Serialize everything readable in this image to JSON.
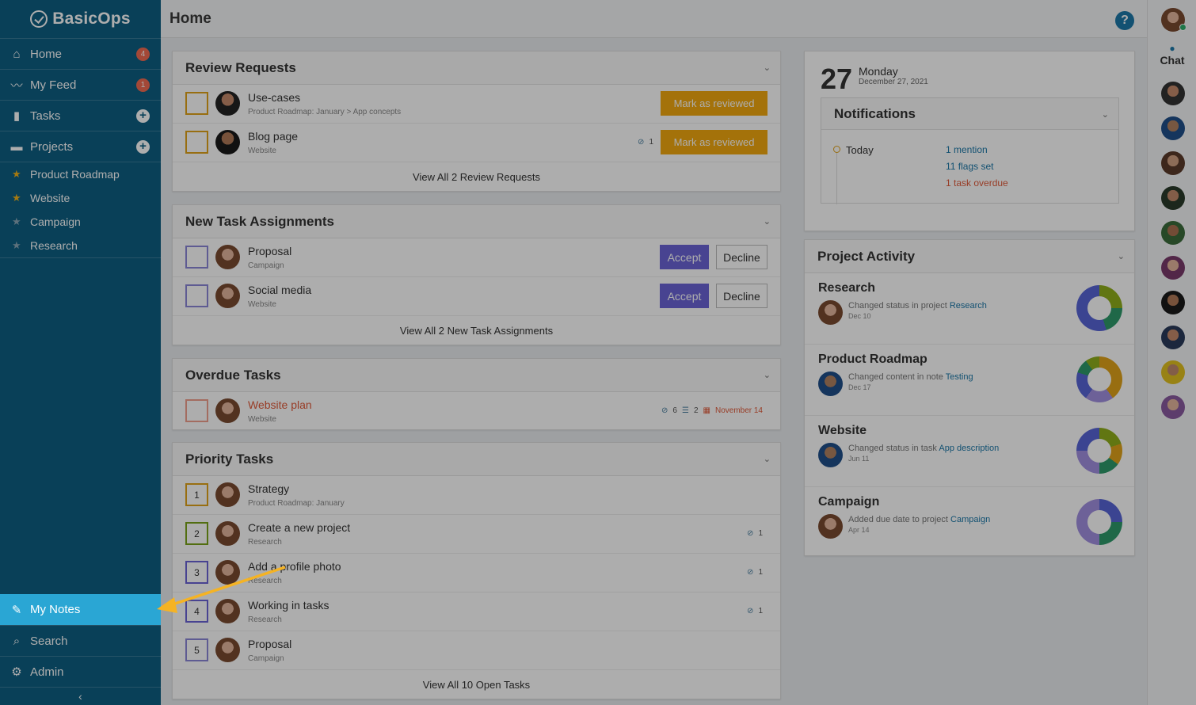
{
  "app": {
    "name": "BasicOps"
  },
  "header": {
    "title": "Home",
    "help": "?"
  },
  "sidebar": {
    "nav": [
      {
        "label": "Home",
        "badge": "4"
      },
      {
        "label": "My Feed",
        "badge": "1"
      },
      {
        "label": "Tasks"
      },
      {
        "label": "Projects"
      }
    ],
    "projects": [
      {
        "label": "Product Roadmap",
        "starred": true
      },
      {
        "label": "Website",
        "starred": true
      },
      {
        "label": "Campaign",
        "starred": false
      },
      {
        "label": "Research",
        "starred": false
      }
    ],
    "bottom": [
      {
        "label": "My Notes"
      },
      {
        "label": "Search"
      },
      {
        "label": "Admin"
      }
    ],
    "collapse": "‹"
  },
  "review": {
    "title": "Review Requests",
    "rows": [
      {
        "title": "Use-cases",
        "sub": "Product Roadmap: January   >  App concepts",
        "button": "Mark as reviewed"
      },
      {
        "title": "Blog page",
        "sub": "Website",
        "attach": "1",
        "button": "Mark as reviewed"
      }
    ],
    "view_all": "View All 2 Review Requests"
  },
  "assignments": {
    "title": "New Task Assignments",
    "rows": [
      {
        "title": "Proposal",
        "sub": "Campaign",
        "accept": "Accept",
        "decline": "Decline"
      },
      {
        "title": "Social media",
        "sub": "Website",
        "accept": "Accept",
        "decline": "Decline"
      }
    ],
    "view_all": "View All 2 New Task Assignments"
  },
  "overdue": {
    "title": "Overdue Tasks",
    "rows": [
      {
        "title": "Website plan",
        "sub": "Website",
        "attach": "6",
        "subtasks": "2",
        "due": "November 14"
      }
    ]
  },
  "priority": {
    "title": "Priority Tasks",
    "rows": [
      {
        "num": "1",
        "title": "Strategy",
        "sub": "Product Roadmap: January",
        "attach": ""
      },
      {
        "num": "2",
        "title": "Create a new project",
        "sub": "Research",
        "attach": "1"
      },
      {
        "num": "3",
        "title": "Add a profile photo",
        "sub": "Research",
        "attach": "1"
      },
      {
        "num": "4",
        "title": "Working in tasks",
        "sub": "Research",
        "attach": "1"
      },
      {
        "num": "5",
        "title": "Proposal",
        "sub": "Campaign",
        "attach": ""
      }
    ],
    "view_all": "View All 10 Open Tasks"
  },
  "date": {
    "num": "27",
    "day": "Monday",
    "full": "December 27, 2021"
  },
  "notifications": {
    "title": "Notifications",
    "today": "Today",
    "items": [
      "1 mention",
      "11 flags set",
      "1 task overdue"
    ]
  },
  "activity": {
    "title": "Project Activity",
    "items": [
      {
        "title": "Research",
        "desc": "Changed status in project",
        "link": "Research",
        "date": "Dec 10"
      },
      {
        "title": "Product Roadmap",
        "desc": "Changed content in note",
        "link": "Testing",
        "date": "Dec 17"
      },
      {
        "title": "Website",
        "desc": "Changed status in task",
        "link": "App description",
        "date": "Jun 11"
      },
      {
        "title": "Campaign",
        "desc": "Added due date to project",
        "link": "Campaign",
        "date": "Apr 14"
      }
    ]
  },
  "chat": {
    "label": "Chat"
  },
  "colors": {
    "sidebar": "#0e5f82",
    "active": "#2aa6d4",
    "review": "#f2a910",
    "accept": "#6b63d6",
    "link": "#1c78a8",
    "overdue": "#e05a3a",
    "arrow": "#f5b324",
    "donut_blue": "#5865d6",
    "donut_green": "#2e9a6a",
    "donut_olive": "#8fae1b",
    "donut_yellow": "#e0a21a",
    "donut_lilac": "#a18fe0"
  }
}
